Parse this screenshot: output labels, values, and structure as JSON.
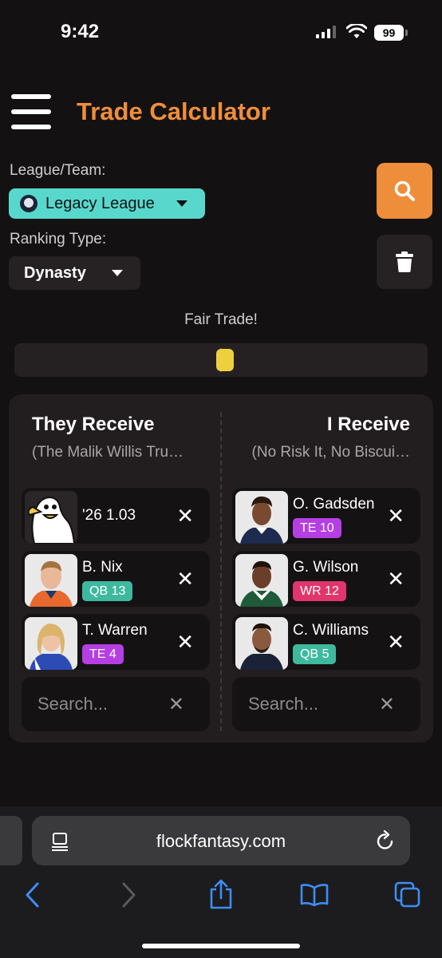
{
  "status": {
    "time": "9:42",
    "battery": "99"
  },
  "header": {
    "title": "Trade Calculator"
  },
  "filters": {
    "league_label": "League/Team:",
    "league_value": "Legacy League",
    "ranking_label": "Ranking Type:",
    "ranking_value": "Dynasty"
  },
  "verdict": {
    "text": "Fair Trade!",
    "balance_fraction": 0.5
  },
  "trade": {
    "left": {
      "title": "They Receive",
      "team": "(The Malik Willis Tru…",
      "items": [
        {
          "name": "'26 1.03",
          "badge": "",
          "badge_color": ""
        },
        {
          "name": "B. Nix",
          "badge": "QB 13",
          "badge_color": "#3fb99e"
        },
        {
          "name": "T. Warren",
          "badge": "TE 4",
          "badge_color": "#b53fe3"
        }
      ],
      "search_placeholder": "Search..."
    },
    "right": {
      "title": "I Receive",
      "team": "(No Risk It, No Biscui…",
      "items": [
        {
          "name": "O. Gadsden",
          "badge": "TE 10",
          "badge_color": "#b53fe3"
        },
        {
          "name": "G. Wilson",
          "badge": "WR 12",
          "badge_color": "#e0366b"
        },
        {
          "name": "C. Williams",
          "badge": "QB 5",
          "badge_color": "#3fb99e"
        }
      ],
      "search_placeholder": "Search..."
    },
    "remove_glyph": "✕",
    "clear_glyph": "✕"
  },
  "browser": {
    "url": "flockfantasy.com"
  },
  "icons": {
    "menu": "hamburger-icon",
    "search": "search-icon",
    "trash": "trash-icon",
    "back": "chevron-left-icon",
    "forward": "chevron-right-icon",
    "share": "share-icon",
    "bookmarks": "book-icon",
    "tabs": "tabs-icon"
  },
  "colors": {
    "accent": "#ef8e3a",
    "league": "#58d8cd",
    "marker": "#ecd03e"
  }
}
